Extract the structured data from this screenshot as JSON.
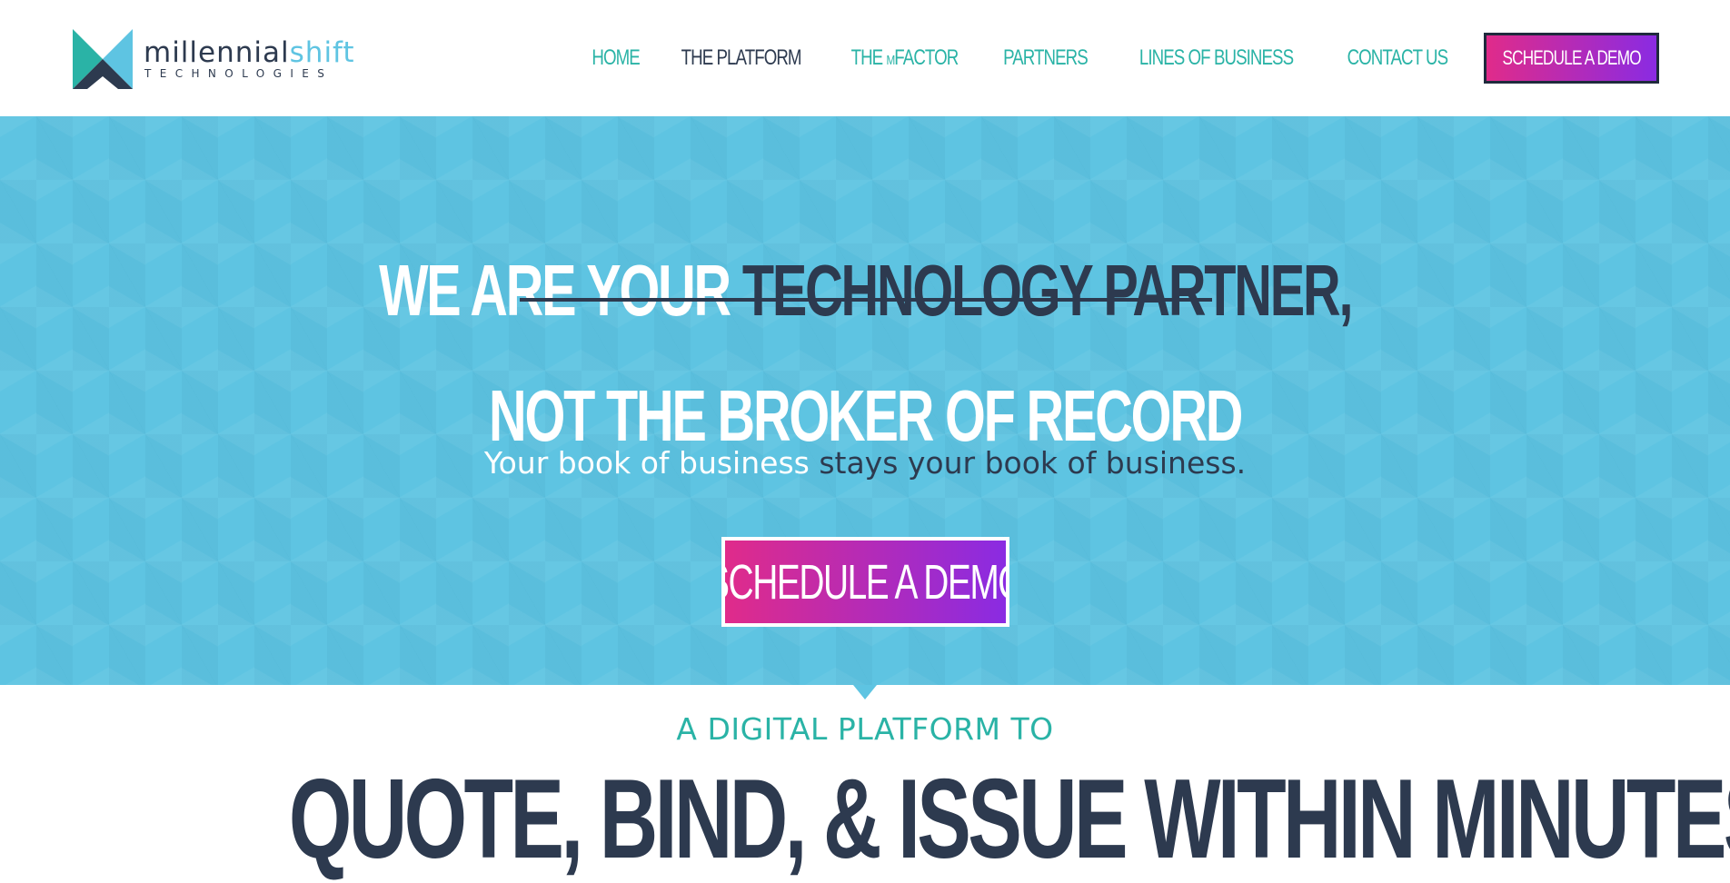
{
  "brand": {
    "name_primary": "millennial",
    "name_accent": "shift",
    "name_sub": "TECHNOLOGIES",
    "colors": {
      "teal": "#2ab3a6",
      "sky": "#5ec4e2",
      "navy": "#2d3a4f",
      "cta_start": "#e02b8a",
      "cta_end": "#8a2be2"
    }
  },
  "nav": {
    "items": [
      {
        "label": "HOME",
        "active": false
      },
      {
        "label": "THE PLATFORM",
        "active": true
      },
      {
        "label_pre": "THE ",
        "label_m": "M",
        "label_post": "FACTOR",
        "active": false
      },
      {
        "label": "PARTNERS",
        "active": false
      },
      {
        "label": "LINES OF BUSINESS",
        "active": false
      },
      {
        "label": "CONTACT US",
        "active": false
      }
    ],
    "cta_label": "SCHEDULE A DEMO"
  },
  "hero": {
    "line1_white": "WE ARE YOUR ",
    "line1_dark": "TECHNOLOGY PARTNER,",
    "line2": "NOT THE BROKER OF RECORD",
    "sub_white": "Your book of business ",
    "sub_dark": "stays your book of business.",
    "cta_label": "SCHEDULE A DEMO"
  },
  "section": {
    "kicker": "A DIGITAL PLATFORM TO",
    "title": "QUOTE, BIND, & ISSUE WITHIN MINUTES"
  }
}
